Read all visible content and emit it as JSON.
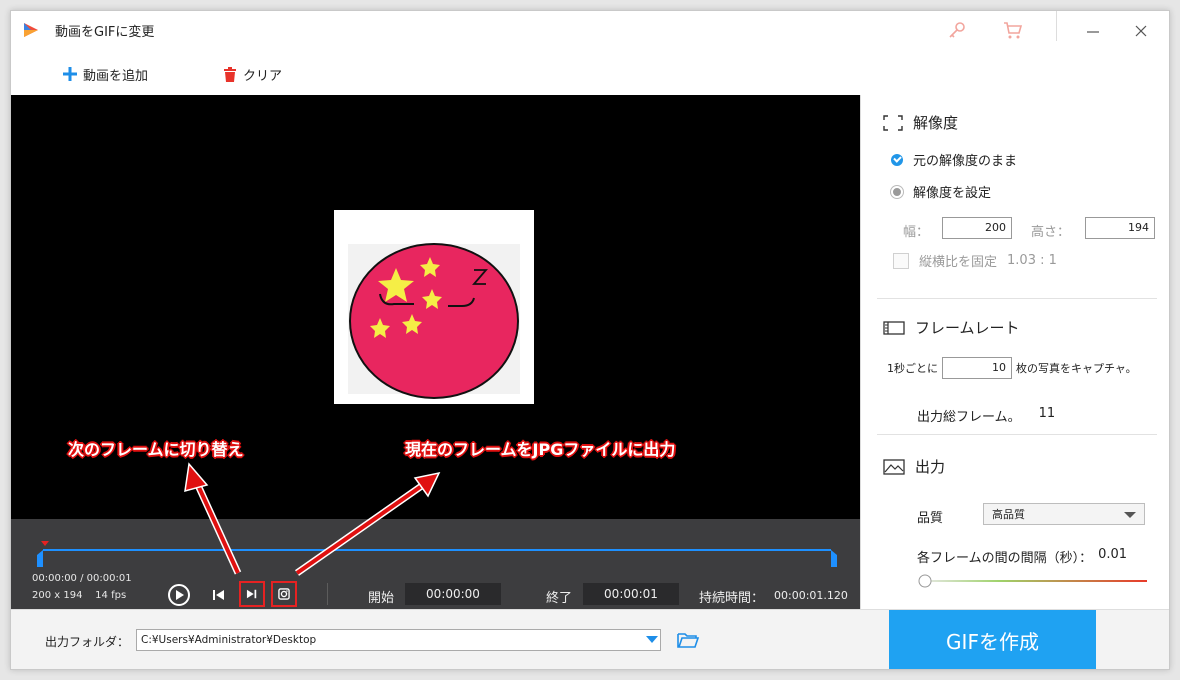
{
  "window": {
    "title": "動画をGIFに変更"
  },
  "toolbar": {
    "add_label": "動画を追加",
    "clear_label": "クリア"
  },
  "player": {
    "time_current": "00:00:00",
    "time_separator": "/",
    "time_total": "00:00:01",
    "resolution": "200 x 194",
    "fps": "14 fps",
    "start_label": "開始",
    "start_value": "00:00:00",
    "end_label": "終了",
    "end_value": "00:00:01",
    "duration_label": "持続時間：",
    "duration_value": "00:00:01.120"
  },
  "annotations": {
    "next_frame": "次のフレームに切り替え",
    "snapshot": "現在のフレームをJPGファイルに出力"
  },
  "resolution": {
    "header": "解像度",
    "option_original": "元の解像度のまま",
    "option_custom": "解像度を設定",
    "selected": "元の解像度のまま",
    "width_label": "幅：",
    "width_value": "200",
    "height_label": "高さ：",
    "height_value": "194",
    "lock_label": "縦横比を固定",
    "ratio": "1.03 : 1"
  },
  "framerate": {
    "header": "フレームレート",
    "prefix": "1秒ごとに",
    "value": "10",
    "suffix": "枚の写真をキャプチャ。",
    "total_label": "出力総フレーム。",
    "total_value": "11"
  },
  "output": {
    "header": "出力",
    "quality_label": "品質",
    "quality_value": "高品質",
    "interval_label": "各フレームの間の間隔（秒）：",
    "interval_value": "0.01"
  },
  "footer": {
    "folder_label": "出力フォルダ：",
    "folder_path": "C:¥Users¥Administrator¥Desktop",
    "create_label": "GIFを作成"
  },
  "colors": {
    "accent": "#1fa2f2",
    "timeline": "#1e90ff",
    "annotation": "#e01010",
    "ball": "#e8265f",
    "star": "#f5ee46"
  }
}
